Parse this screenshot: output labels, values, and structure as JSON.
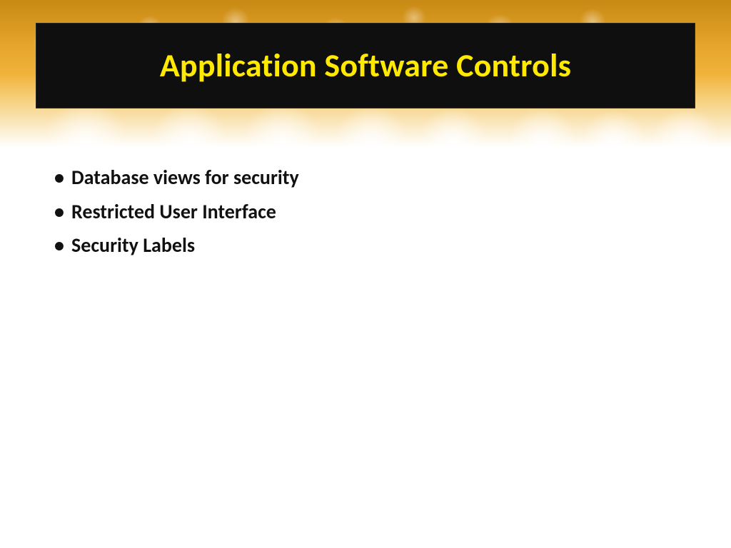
{
  "title": "Application Software Controls",
  "bullets": [
    "Database views for security",
    "Restricted User Interface",
    "Security Labels"
  ],
  "colors": {
    "title_bg": "#0f0f0f",
    "title_fg": "#ffe900",
    "accent": "#e6a52c",
    "text": "#111111"
  }
}
